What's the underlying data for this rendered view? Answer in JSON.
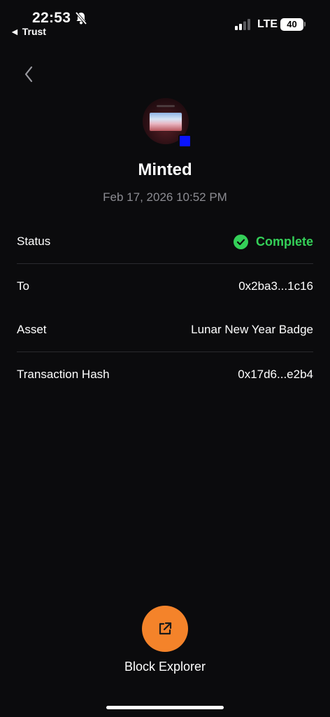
{
  "status_bar": {
    "time": "22:53",
    "back_app": "◄ Trust",
    "network": "LTE",
    "battery": "40"
  },
  "header": {
    "title": "Minted",
    "date": "Feb 17, 2026 10:52 PM"
  },
  "details": [
    {
      "label": "Status",
      "value": "Complete"
    },
    {
      "label": "To",
      "value": "0x2ba3...1c16"
    },
    {
      "label": "Asset",
      "value": "Lunar New Year Badge"
    },
    {
      "label": "Transaction Hash",
      "value": "0x17d6...e2b4"
    }
  ],
  "actions": {
    "block_explorer_label": "Block Explorer"
  },
  "colors": {
    "background": "#0b0b0d",
    "status_complete": "#34d058",
    "accent_button": "#f4832a",
    "chain_badge": "#0a14ff",
    "muted_text": "#8c8c92"
  },
  "icons": {
    "back": "chevron-left-icon",
    "status": "check-circle-icon",
    "explorer": "external-link-icon",
    "silent": "bell-slash-icon",
    "signal": "signal-bars-icon"
  }
}
